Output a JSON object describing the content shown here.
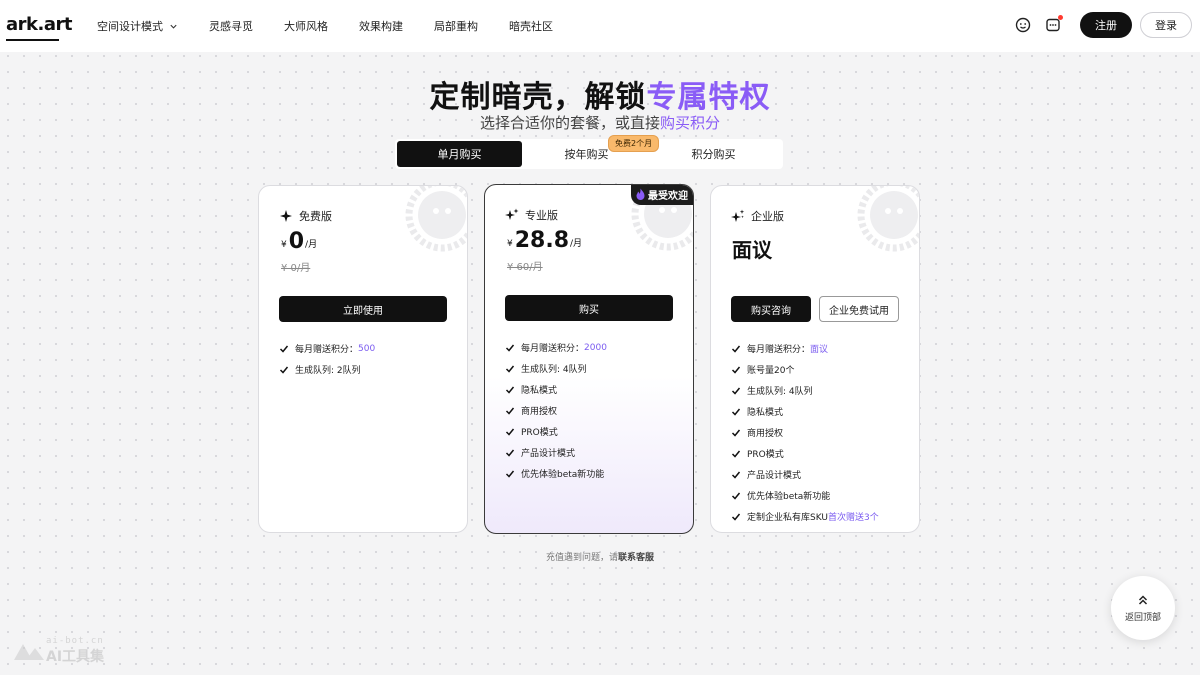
{
  "brand": {
    "logo_text": "ark.art",
    "accent_color": "#8a5cf6"
  },
  "nav": {
    "items": [
      {
        "label": "空间设计模式",
        "has_dropdown": true
      },
      {
        "label": "灵感寻觅"
      },
      {
        "label": "大师风格"
      },
      {
        "label": "效果构建"
      },
      {
        "label": "局部重构"
      },
      {
        "label": "暗壳社区"
      }
    ],
    "icons": [
      "feedback-icon",
      "message-icon"
    ],
    "register_label": "注册",
    "login_label": "登录"
  },
  "hero": {
    "title_main": "定制暗壳，解锁",
    "title_accent": "专属特权",
    "subtitle_main": "选择合适你的套餐，或直接",
    "subtitle_accent": "购买积分"
  },
  "tabs": {
    "items": [
      {
        "label": "单月购买",
        "active": true
      },
      {
        "label": "按年购买",
        "active": false
      },
      {
        "label": "积分购买",
        "active": false
      }
    ],
    "badge": "免费2个月"
  },
  "plans": [
    {
      "name": "免费版",
      "currency": "¥",
      "price": "0",
      "unit": "/月",
      "original": "¥ 0/月",
      "cta": "立即使用",
      "features": [
        {
          "text": "每月赠送积分：",
          "highlight": "500"
        },
        {
          "text": "生成队列: 2队列",
          "highlight": ""
        }
      ]
    },
    {
      "name": "专业版",
      "badge": "最受欢迎",
      "currency": "¥",
      "price": "28.8",
      "unit": "/月",
      "original": "¥ 60/月",
      "cta": "购买",
      "features": [
        {
          "text": "每月赠送积分：",
          "highlight": "2000"
        },
        {
          "text": "生成队列: 4队列",
          "highlight": ""
        },
        {
          "text": "隐私模式",
          "highlight": ""
        },
        {
          "text": "商用授权",
          "highlight": ""
        },
        {
          "text": "PRO模式",
          "highlight": ""
        },
        {
          "text": "产品设计模式",
          "highlight": ""
        },
        {
          "text": "优先体验beta新功能",
          "highlight": ""
        }
      ]
    },
    {
      "name": "企业版",
      "price_text": "面议",
      "cta_primary": "购买咨询",
      "cta_secondary": "企业免费试用",
      "features": [
        {
          "text": "每月赠送积分：",
          "highlight": "面议"
        },
        {
          "text": "账号量20个",
          "highlight": ""
        },
        {
          "text": "生成队列: 4队列",
          "highlight": ""
        },
        {
          "text": "隐私模式",
          "highlight": ""
        },
        {
          "text": "商用授权",
          "highlight": ""
        },
        {
          "text": "PRO模式",
          "highlight": ""
        },
        {
          "text": "产品设计模式",
          "highlight": ""
        },
        {
          "text": "优先体验beta新功能",
          "highlight": ""
        },
        {
          "text": "定制企业私有库SKU",
          "highlight": "首次赠送3个"
        }
      ]
    }
  ],
  "footer": {
    "note_main": "充值遇到问题，请",
    "note_link": "联系客服"
  },
  "back_to_top": "返回顶部",
  "watermark": {
    "line1": "ai-bot.cn",
    "line2": "AI工具集"
  }
}
